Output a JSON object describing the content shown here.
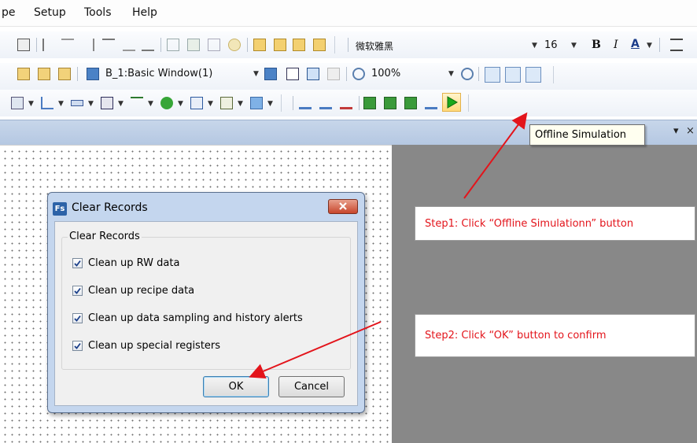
{
  "menu": {
    "items": [
      "pe",
      "Setup",
      "Tools",
      "Help"
    ]
  },
  "toolbar1": {
    "font_name": "微软雅黑",
    "font_size": "16",
    "bold": "B",
    "italic": "I",
    "font_color": "A"
  },
  "toolbar2": {
    "window_select": "B_1:Basic Window(1)",
    "zoom": "100%"
  },
  "tooltip": {
    "text": "Offline Simulation"
  },
  "dialog": {
    "title_icon": "Fs",
    "title": "Clear Records",
    "group_label": "Clear Records",
    "options": [
      {
        "label": "Clean up RW data",
        "checked": true
      },
      {
        "label": "Clean up recipe data",
        "checked": true
      },
      {
        "label": "Clean up data sampling and history alerts",
        "checked": true
      },
      {
        "label": "Clean up special registers",
        "checked": true
      }
    ],
    "ok_label": "OK",
    "cancel_label": "Cancel"
  },
  "steps": {
    "step1": "Step1: Click “Offline Simulationn” button",
    "step2": "Step2: Click “OK” button to confirm"
  },
  "colors": {
    "annotation_red": "#e3141b",
    "simulation_green": "#1aa81a"
  }
}
